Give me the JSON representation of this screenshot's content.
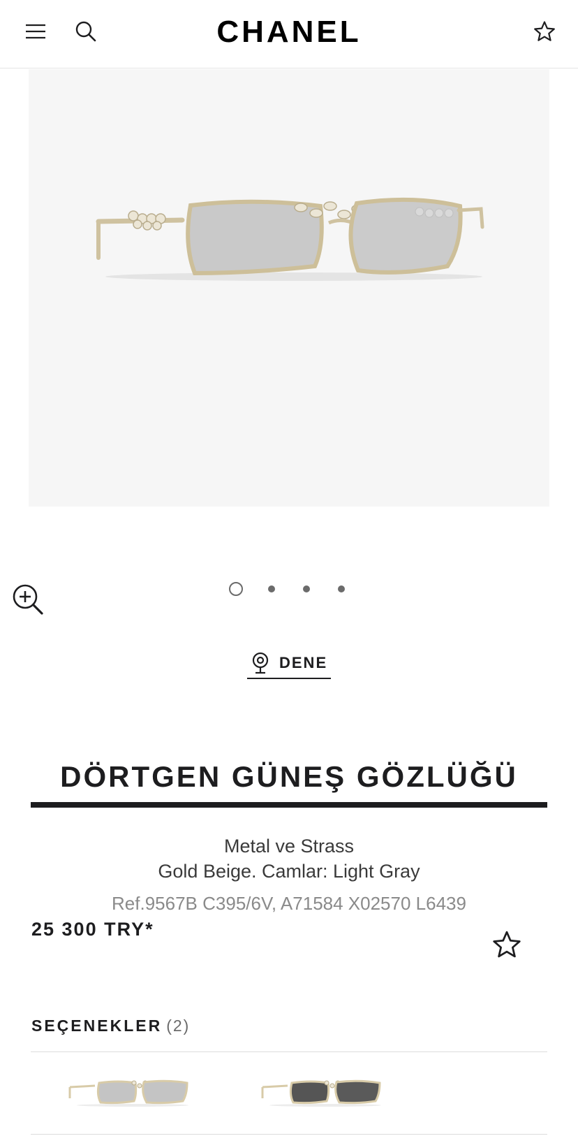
{
  "header": {
    "logo": "CHANEL",
    "icons": [
      "hamburger-menu-icon",
      "search-icon",
      "star-icon"
    ]
  },
  "gallery": {
    "slide_count": 4,
    "active_slide": 1,
    "image_background": "#f6f6f6"
  },
  "try_on": {
    "label": "DENE"
  },
  "product": {
    "title": "DÖRTGEN GÜNEŞ GÖZLÜĞÜ",
    "material": "Metal ve Strass",
    "color": "Gold Beige. Camlar: Light Gray",
    "reference": "Ref.9567B C395/6V, A71584 X02570 L6439",
    "price": "25 300 TRY*"
  },
  "options": {
    "label": "SEÇENEKLER",
    "count": "(2)",
    "variants": [
      {
        "lens_color": "#c4c4c4",
        "frame_color": "#d8cba8"
      },
      {
        "lens_color": "#555555",
        "frame_color": "#d8cba8"
      }
    ]
  },
  "colors": {
    "text": "#1d1d1f",
    "muted": "#8a8a8a",
    "frame_gold": "#d8cba8"
  }
}
